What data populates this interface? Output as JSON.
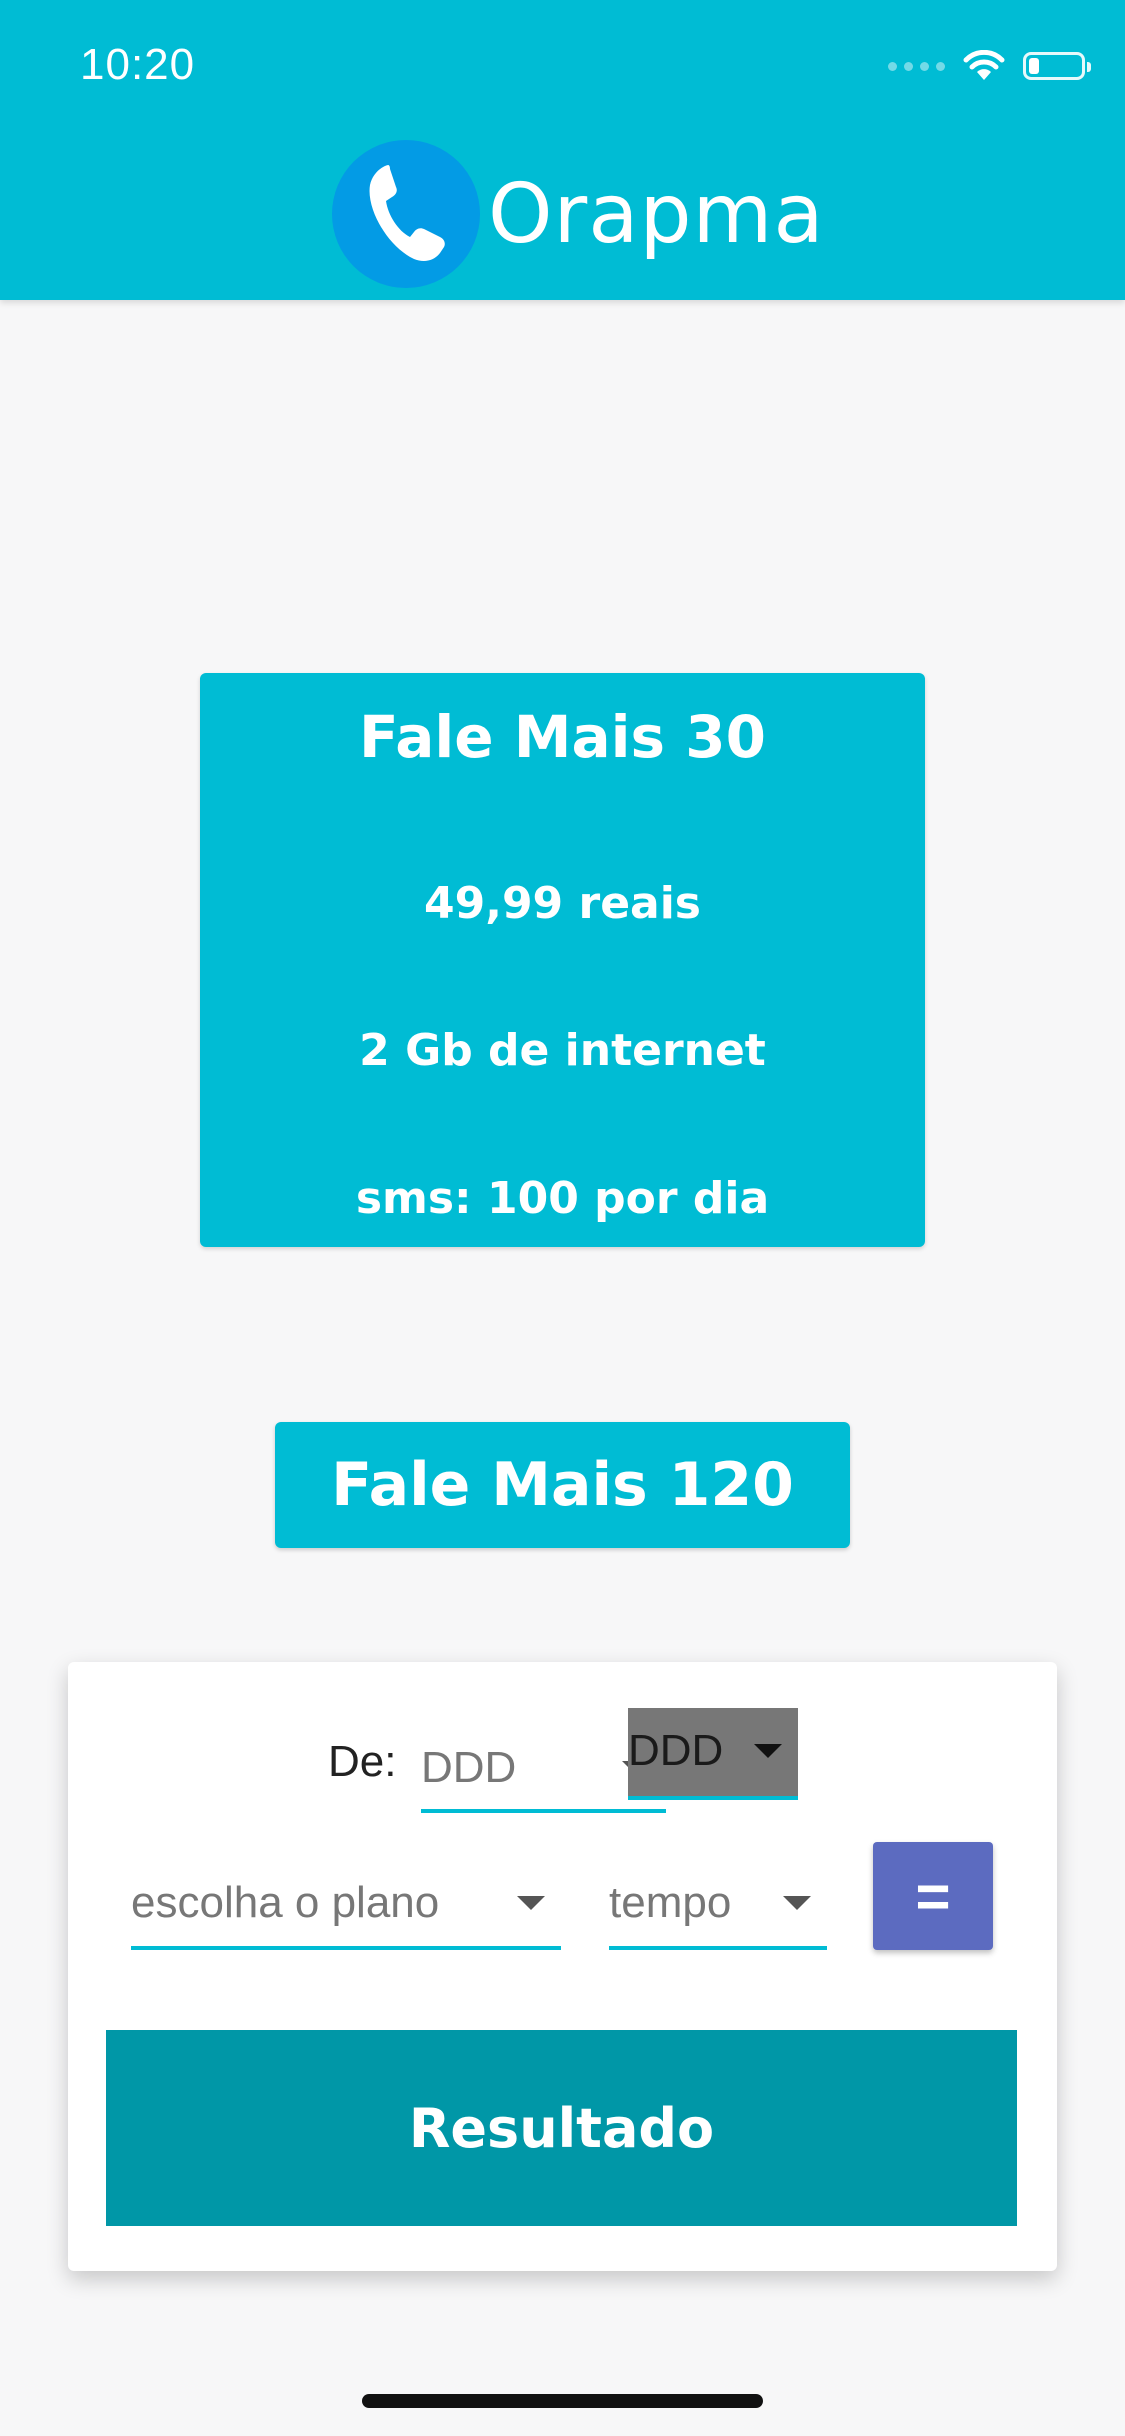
{
  "status_bar": {
    "time": "10:20"
  },
  "header": {
    "app_name": "Orapma",
    "logo_icon": "phone-icon"
  },
  "plan_card": {
    "title": "Fale Mais 30",
    "price": "49,99 reais",
    "internet": "2 Gb de internet",
    "sms": "sms: 100 por dia"
  },
  "plan_toggle": {
    "label": "Fale Mais 120"
  },
  "calculator": {
    "from_label": "De:",
    "ddd_from": {
      "placeholder": "DDD"
    },
    "ddd_to": {
      "placeholder": "DDD"
    },
    "plan_select": {
      "placeholder": "escolha o plano"
    },
    "time_select": {
      "placeholder": "tempo"
    },
    "equals_label": "=",
    "result_label": "Resultado"
  },
  "colors": {
    "primary": "#00bcd4",
    "logo_circle": "#039be5",
    "equals_button": "#5c6bc0",
    "result_button": "#0097a7",
    "selected_dropdown": "#777777"
  }
}
